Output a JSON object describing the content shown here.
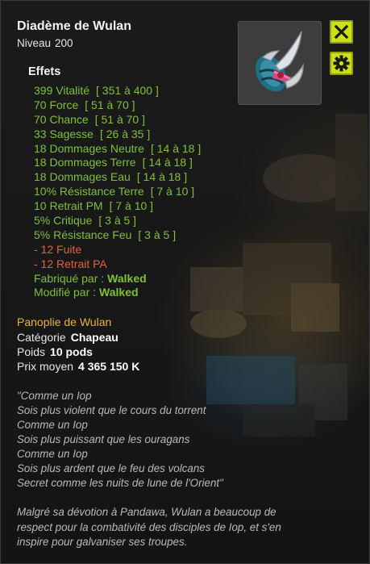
{
  "item": {
    "name": "Diadème de Wulan",
    "level_label": "Niveau",
    "level": "200"
  },
  "buttons": {
    "close_icon": "close-x-icon",
    "settings_icon": "gear-icon"
  },
  "effects": {
    "title": "Effets",
    "lines": [
      {
        "text": "399 Vitalité",
        "range": "[ 351 à 400 ]",
        "kind": "positive"
      },
      {
        "text": "70 Force",
        "range": "[ 51 à 70 ]",
        "kind": "positive"
      },
      {
        "text": "70 Chance",
        "range": "[ 51 à 70 ]",
        "kind": "positive"
      },
      {
        "text": "33 Sagesse",
        "range": "[ 26 à 35 ]",
        "kind": "positive"
      },
      {
        "text": "18 Dommages Neutre",
        "range": "[ 14 à 18 ]",
        "kind": "positive"
      },
      {
        "text": "18 Dommages Terre",
        "range": "[ 14 à 18 ]",
        "kind": "positive"
      },
      {
        "text": "18 Dommages Eau",
        "range": "[ 14 à 18 ]",
        "kind": "positive"
      },
      {
        "text": "10% Résistance Terre",
        "range": "[ 7 à 10 ]",
        "kind": "positive"
      },
      {
        "text": "10 Retrait PM",
        "range": "[ 7 à 10 ]",
        "kind": "positive"
      },
      {
        "text": "5% Critique",
        "range": "[ 3 à 5 ]",
        "kind": "positive"
      },
      {
        "text": "5% Résistance Feu",
        "range": "[ 3 à 5 ]",
        "kind": "positive"
      },
      {
        "text": "- 12 Fuite",
        "range": "",
        "kind": "negative"
      },
      {
        "text": "- 12 Retrait PA",
        "range": "",
        "kind": "negative"
      }
    ],
    "crafted_label": "Fabriqué par :",
    "crafted_by": "Walked",
    "modified_label": "Modifié par :",
    "modified_by": "Walked"
  },
  "details": {
    "set_name": "Panoplie de Wulan",
    "category_label": "Catégorie",
    "category_value": "Chapeau",
    "weight_label": "Poids",
    "weight_value": "10 pods",
    "price_label": "Prix moyen",
    "price_value": "4 365 150 K"
  },
  "description": {
    "poem": [
      "\"Comme un Iop",
      "Sois plus violent que le cours du torrent",
      "Comme un Iop",
      "Sois plus puissant que les ouragans",
      "Comme un Iop",
      "Sois plus ardent que le feu des volcans",
      "Secret comme les nuits de lune de l'Orient\""
    ],
    "lore": [
      "Malgré sa dévotion à Pandawa, Wulan a beaucoup de",
      "respect pour la combativité des disciples de Iop, et s'en",
      "inspire pour galvaniser ses troupes."
    ]
  },
  "colors": {
    "positive_effect": "#7ec03a",
    "negative_effect": "#e2603c",
    "set_name": "#e8b52b",
    "button_accent": "#cbe019"
  }
}
